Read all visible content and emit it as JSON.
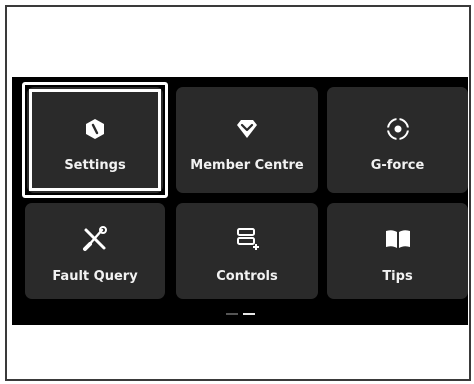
{
  "menu": {
    "tiles": [
      {
        "label": "Settings",
        "icon": "settings-hexagon-icon"
      },
      {
        "label": "Member Centre",
        "icon": "diamond-icon"
      },
      {
        "label": "G-force",
        "icon": "target-icon"
      },
      {
        "label": "Fault Query",
        "icon": "tools-icon"
      },
      {
        "label": "Controls",
        "icon": "controls-icon"
      },
      {
        "label": "Tips",
        "icon": "book-icon"
      }
    ],
    "selected_index": 0
  },
  "pager": {
    "pages": 2,
    "current_page": 2
  },
  "colors": {
    "screen_bg": "#000000",
    "tile_bg": "#2a2a2a",
    "text": "#ffffff",
    "selection": "#ffffff"
  }
}
